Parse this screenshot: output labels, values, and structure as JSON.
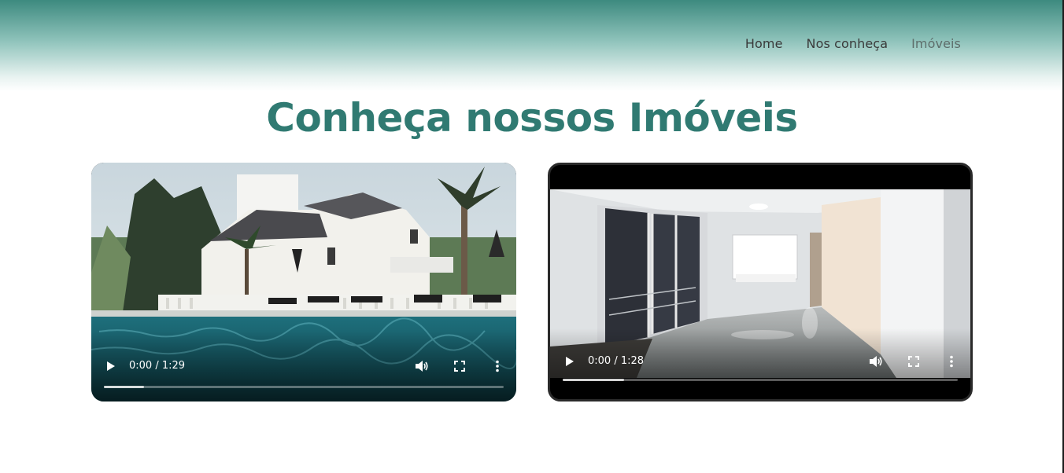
{
  "nav": {
    "items": [
      {
        "label": "Home"
      },
      {
        "label": "Nos conheça"
      },
      {
        "label": "Imóveis"
      }
    ]
  },
  "page_title": "Conheça nossos Imóveis",
  "videos": [
    {
      "time": "0:00 / 1:29",
      "buffered": 0.1
    },
    {
      "time": "0:00 / 1:28",
      "buffered": 0.155
    }
  ],
  "colors": {
    "brand": "#307a72",
    "header_top": "#3d8a7f"
  },
  "icons": [
    "play-icon",
    "volume-icon",
    "fullscreen-icon",
    "more-options-icon"
  ]
}
